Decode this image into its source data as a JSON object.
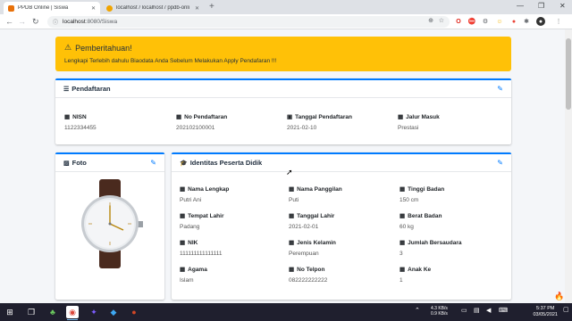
{
  "browser": {
    "tabs": [
      {
        "label": "PPDB Online | Siswa",
        "active": true
      },
      {
        "label": "localhost / localhost / ppdb-onli",
        "active": false
      }
    ],
    "url_host": "localhost",
    "url_path": ":8080/Siswa"
  },
  "alert": {
    "title": "Pemberitahuan!",
    "text": "Lengkapi Terlebih dahulu Biaodata Anda Sebelum Melakukan Apply Pendafaran !!!"
  },
  "pendaftaran": {
    "title": "Pendaftaran",
    "fields": [
      {
        "label": "NISN",
        "value": "1122334455"
      },
      {
        "label": "No Pendaftaran",
        "value": "202102100001"
      },
      {
        "label": "Tanggal Pendaftaran",
        "value": "2021-02-10"
      },
      {
        "label": "Jalur Masuk",
        "value": "Prestasi"
      }
    ]
  },
  "foto": {
    "title": "Foto"
  },
  "identitas": {
    "title": "Identitas Peserta Didik",
    "fields": [
      {
        "label": "Nama Lengkap",
        "value": "Putri Ani"
      },
      {
        "label": "Nama Panggilan",
        "value": "Puti"
      },
      {
        "label": "Tinggi Badan",
        "value": "150 cm"
      },
      {
        "label": "Tempat Lahir",
        "value": "Padang"
      },
      {
        "label": "Tanggal Lahir",
        "value": "2021-02-01"
      },
      {
        "label": "Berat Badan",
        "value": "60 kg"
      },
      {
        "label": "NIK",
        "value": "111111111111111"
      },
      {
        "label": "Jenis Kelamin",
        "value": "Perempuan"
      },
      {
        "label": "Jumlah Bersaudara",
        "value": "3"
      },
      {
        "label": "Agama",
        "value": "Islam"
      },
      {
        "label": "No Telpon",
        "value": "082222222222"
      },
      {
        "label": "Anak Ke",
        "value": "1"
      }
    ]
  },
  "taskbar": {
    "net_up": "4.3 KB/s",
    "net_down": "0.9 KB/s",
    "time": "5:37 PM",
    "date": "03/05/2021"
  },
  "colors": {
    "primary": "#007bff",
    "warning": "#ffc107",
    "taskbar": "#1f1f2e"
  }
}
